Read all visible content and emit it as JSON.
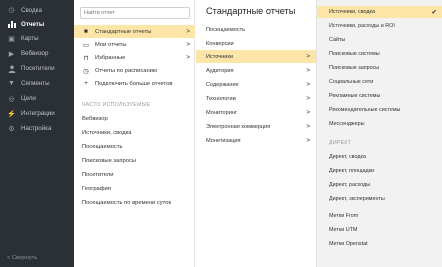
{
  "sidebar": {
    "items": [
      {
        "label": "Сводка",
        "icon": "clock-icon"
      },
      {
        "label": "Отчеты",
        "icon": "bar-chart-icon"
      },
      {
        "label": "Карты",
        "icon": "map-icon"
      },
      {
        "label": "Вебвизор",
        "icon": "play-icon"
      },
      {
        "label": "Посетители",
        "icon": "user-icon"
      },
      {
        "label": "Сегменты",
        "icon": "filter-icon"
      },
      {
        "label": "Цели",
        "icon": "target-icon"
      },
      {
        "label": "Интеграции",
        "icon": "plug-icon"
      },
      {
        "label": "Настройка",
        "icon": "gear-icon"
      }
    ],
    "collapse_label": "< Свернуть"
  },
  "menu": {
    "search_placeholder": "Найти отчет",
    "items": [
      {
        "label": "Стандартные отчеты",
        "icon": "■",
        "arrow": ">"
      },
      {
        "label": "Мои отчеты",
        "icon": "▢",
        "arrow": ">"
      },
      {
        "label": "Избранные",
        "icon": "⌑",
        "arrow": ">"
      },
      {
        "label": "Отчеты по расписанию",
        "icon": "◷",
        "arrow": ""
      },
      {
        "label": "Подключить больше отчетов",
        "icon": "+",
        "arrow": ""
      }
    ],
    "frequent_header": "ЧАСТО ИСПОЛЬЗУЕМЫЕ",
    "frequent": [
      "Вебвизор",
      "Источники, сводка",
      "Посещаемость",
      "Поисковые запросы",
      "Посетители",
      "География",
      "Посещаемость по времени суток"
    ]
  },
  "standard": {
    "title": "Стандартные отчеты",
    "items": [
      {
        "label": "Посещаемость",
        "arrow": ""
      },
      {
        "label": "Конверсии",
        "arrow": ""
      },
      {
        "label": "Источники",
        "arrow": ">"
      },
      {
        "label": "Аудитория",
        "arrow": ">"
      },
      {
        "label": "Содержание",
        "arrow": ">"
      },
      {
        "label": "Технологии",
        "arrow": ">"
      },
      {
        "label": "Мониторинг",
        "arrow": ">"
      },
      {
        "label": "Электронная коммерция",
        "arrow": ">"
      },
      {
        "label": "Монетизация",
        "arrow": ">"
      }
    ]
  },
  "sources": {
    "items": [
      "Источники, сводка",
      "Источники, расходы и ROI",
      "Сайты",
      "Поисковые системы",
      "Поисковые запросы",
      "Социальные сети",
      "Рекламные системы",
      "Рекомендательные системы",
      "Мессенджеры"
    ],
    "check": "✔",
    "direct_header": "ДИРЕКТ",
    "direct": [
      "Директ, сводка",
      "Директ, площадки",
      "Директ, расходы",
      "Директ, эксперименты"
    ],
    "tags": [
      "Метки From",
      "Метки UTM",
      "Метки Openstat"
    ]
  },
  "colors": {
    "sidebar_bg": "#2b2f36",
    "highlight": "#fde5a8",
    "sources_bg": "#f2f2f2"
  }
}
